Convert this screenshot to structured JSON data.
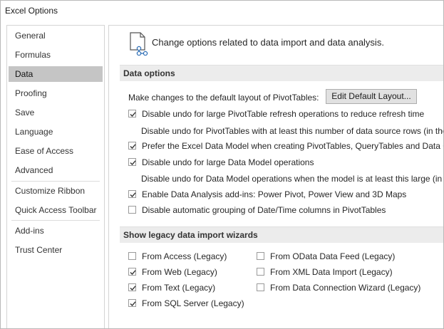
{
  "window": {
    "title": "Excel Options"
  },
  "sidebar": {
    "items": [
      {
        "label": "General"
      },
      {
        "label": "Formulas"
      },
      {
        "label": "Data"
      },
      {
        "label": "Proofing"
      },
      {
        "label": "Save"
      },
      {
        "label": "Language"
      },
      {
        "label": "Ease of Access"
      },
      {
        "label": "Advanced"
      },
      {
        "label": "Customize Ribbon"
      },
      {
        "label": "Quick Access Toolbar"
      },
      {
        "label": "Add-ins"
      },
      {
        "label": "Trust Center"
      }
    ],
    "selected": "Data"
  },
  "header": {
    "text": "Change options related to data import and data analysis.",
    "icon": "data-import-icon"
  },
  "data_options": {
    "title": "Data options",
    "layout_label": "Make changes to the default layout of PivotTables:",
    "edit_button": "Edit Default Layout...",
    "opt1": "Disable undo for large PivotTable refresh operations to reduce refresh time",
    "sub1": "Disable undo for PivotTables with at least this number of data source rows (in tho",
    "opt2": "Prefer the Excel Data Model when creating PivotTables, QueryTables and Data Co",
    "opt3": "Disable undo for large Data Model operations",
    "sub3": "Disable undo for Data Model operations when the model is at least this large (in M",
    "opt4": "Enable Data Analysis add-ins: Power Pivot, Power View and 3D Maps",
    "opt5": "Disable automatic grouping of Date/Time columns in PivotTables"
  },
  "legacy": {
    "title": "Show legacy data import wizards",
    "access": "From Access (Legacy)",
    "web": "From Web (Legacy)",
    "text": "From Text (Legacy)",
    "sql": "From SQL Server (Legacy)",
    "odata": "From OData Data Feed (Legacy)",
    "xml": "From XML Data Import (Legacy)",
    "dcw": "From Data Connection Wizard (Legacy)"
  },
  "colors": {
    "selected_bg": "#c5c5c5",
    "section_bg": "#ececec",
    "check": "#333333"
  }
}
